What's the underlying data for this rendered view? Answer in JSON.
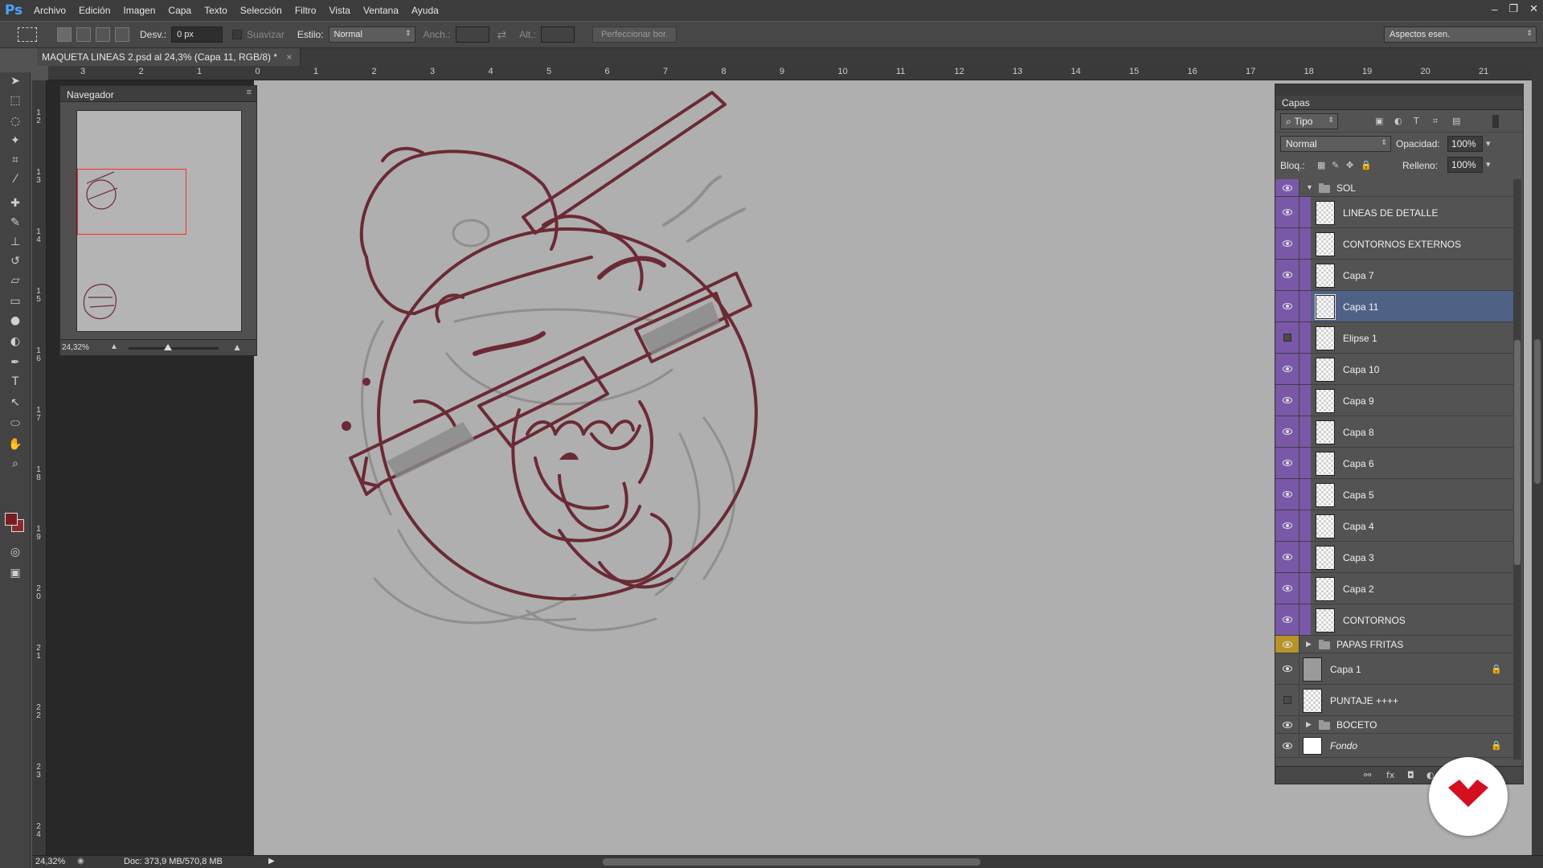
{
  "app": {
    "logo": "Ps",
    "menu": [
      "Archivo",
      "Edición",
      "Imagen",
      "Capa",
      "Texto",
      "Selección",
      "Filtro",
      "Vista",
      "Ventana",
      "Ayuda"
    ],
    "window_controls": [
      "–",
      "❐",
      "✕"
    ]
  },
  "options_bar": {
    "feather_label": "Desv.:",
    "feather_value": "0 px",
    "antialias_label": "Suavizar",
    "style_label": "Estilo:",
    "style_value": "Normal",
    "width_label": "Anch.:",
    "height_label": "Alt.:",
    "refine_button": "Perfeccionar bor.",
    "workspace": "Aspectos esen."
  },
  "document_tab": {
    "title": "MAQUETA LINEAS 2.psd al 24,3% (Capa 11, RGB/8) *",
    "close": "×"
  },
  "rulers": {
    "top": [
      "3",
      "2",
      "1",
      "0",
      "1",
      "2",
      "3",
      "4",
      "5",
      "6",
      "7",
      "8",
      "9",
      "10",
      "11",
      "12",
      "13",
      "14",
      "15",
      "16",
      "17",
      "18",
      "19",
      "20",
      "21"
    ],
    "left": [
      "1",
      "2",
      "1",
      "3",
      "1",
      "4",
      "1",
      "5",
      "1",
      "6",
      "1",
      "7",
      "1",
      "8",
      "1",
      "9",
      "2",
      "0",
      "2",
      "1",
      "2",
      "2",
      "2",
      "3",
      "2",
      "4"
    ]
  },
  "navigator": {
    "title": "Navegador",
    "zoom": "24,32%",
    "view_box_color": "#ff2a2a"
  },
  "layers_panel": {
    "title": "Capas",
    "filter_kind": "Tipo",
    "blend_mode": "Normal",
    "opacity_label": "Opacidad:",
    "opacity_value": "100%",
    "lock_label": "Bloq.:",
    "fill_label": "Relleno:",
    "fill_value": "100%",
    "layers": [
      {
        "name": "SOL",
        "type": "group",
        "visible": true,
        "expanded": true,
        "color": "purple"
      },
      {
        "name": "LINEAS DE DETALLE",
        "type": "layer",
        "visible": true,
        "color": "purple"
      },
      {
        "name": "CONTORNOS EXTERNOS",
        "type": "layer",
        "visible": true,
        "color": "purple"
      },
      {
        "name": "Capa 7",
        "type": "layer",
        "visible": true,
        "color": "purple"
      },
      {
        "name": "Capa 11",
        "type": "layer",
        "visible": true,
        "color": "purple",
        "selected": true
      },
      {
        "name": "Elipse 1",
        "type": "layer",
        "visible": false,
        "color": "purple"
      },
      {
        "name": "Capa 10",
        "type": "layer",
        "visible": true,
        "color": "purple"
      },
      {
        "name": "Capa 9",
        "type": "layer",
        "visible": true,
        "color": "purple"
      },
      {
        "name": "Capa 8",
        "type": "layer",
        "visible": true,
        "color": "purple"
      },
      {
        "name": "Capa 6",
        "type": "layer",
        "visible": true,
        "color": "purple"
      },
      {
        "name": "Capa 5",
        "type": "layer",
        "visible": true,
        "color": "purple"
      },
      {
        "name": "Capa 4",
        "type": "layer",
        "visible": true,
        "color": "purple"
      },
      {
        "name": "Capa 3",
        "type": "layer",
        "visible": true,
        "color": "purple"
      },
      {
        "name": "Capa 2",
        "type": "layer",
        "visible": true,
        "color": "purple"
      },
      {
        "name": "CONTORNOS",
        "type": "layer",
        "visible": true,
        "color": "purple"
      },
      {
        "name": "PAPAS FRITAS",
        "type": "group",
        "visible": true,
        "expanded": false,
        "color": "yellow"
      },
      {
        "name": "Capa 1",
        "type": "layer",
        "visible": true,
        "locked": true
      },
      {
        "name": "PUNTAJE ++++",
        "type": "layer",
        "visible": false
      },
      {
        "name": "BOCETO",
        "type": "group",
        "visible": true,
        "expanded": false
      },
      {
        "name": "Fondo",
        "type": "background",
        "visible": true,
        "locked": true
      }
    ]
  },
  "status_bar": {
    "zoom": "24,32%",
    "doc_info": "Doc: 373,9 MB/570,8 MB"
  },
  "colors": {
    "foreground": "#7a1c22",
    "background": "#8a2a30",
    "sketch_line": "#6b2a35",
    "layer_label_purple": "#7a58a8",
    "layer_label_yellow": "#b89428",
    "selection": "#4f6285"
  }
}
